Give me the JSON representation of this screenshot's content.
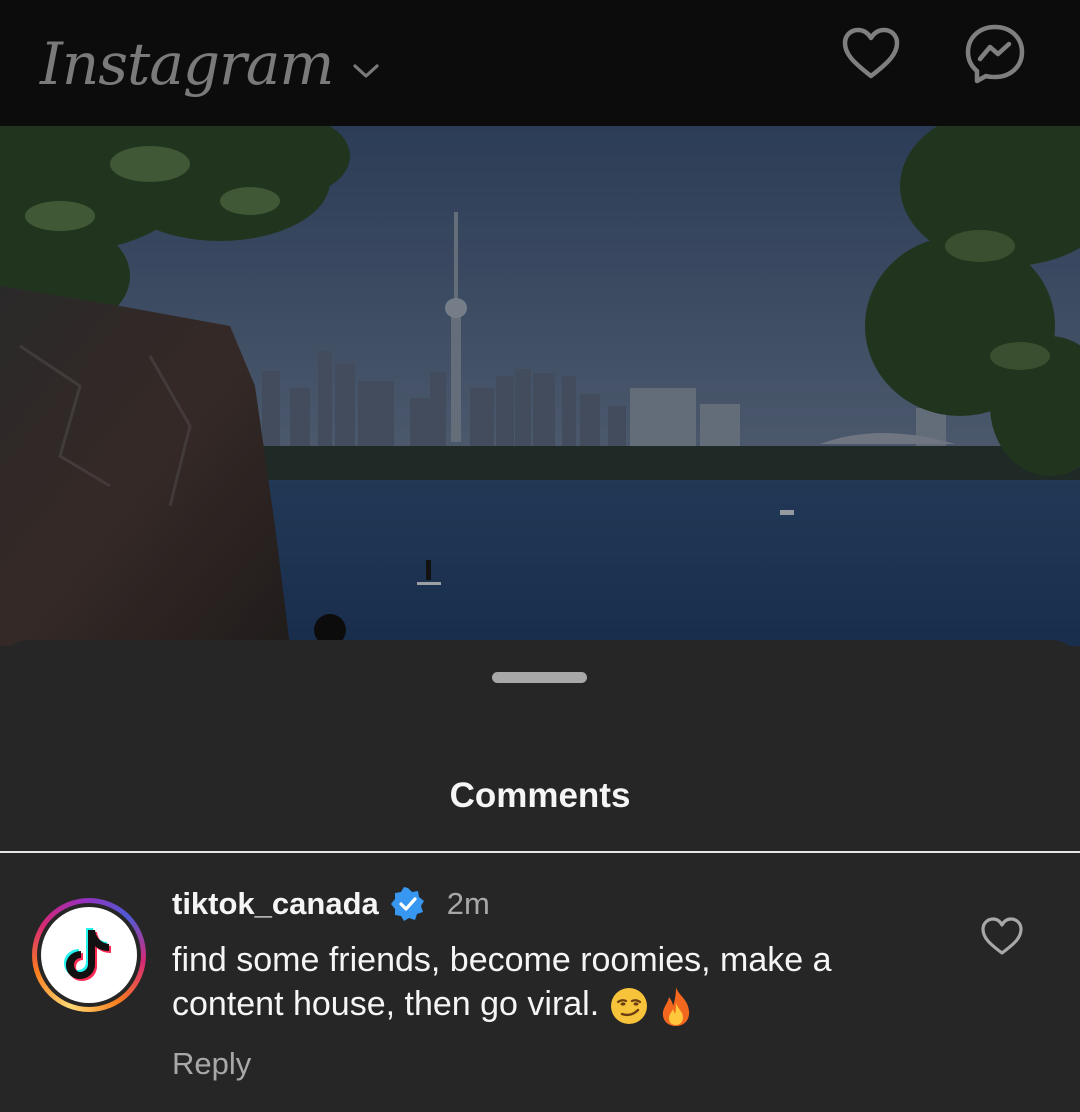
{
  "header": {
    "logo_text": "Instagram",
    "logo_menu_icon": "chevron-down-icon",
    "icons": [
      "heart-icon",
      "messenger-icon"
    ]
  },
  "post": {
    "image_description_icon": "photo"
  },
  "sheet": {
    "title": "Comments"
  },
  "comment": {
    "username": "tiktok_canada",
    "verified_icon": "verified-badge-icon",
    "time": "2m",
    "text": "find some friends, become roomies, make a content house, then go viral.",
    "emojis": [
      "smirking-face-emoji",
      "fire-emoji"
    ],
    "reply_label": "Reply",
    "like_icon": "heart-outline-icon"
  },
  "colors": {
    "topbar_bg": "#0c0c0c",
    "sheet_bg": "#262626",
    "text_primary": "#f5f5f5",
    "text_secondary": "#a8a8a8",
    "verified_blue": "#3897f0"
  }
}
